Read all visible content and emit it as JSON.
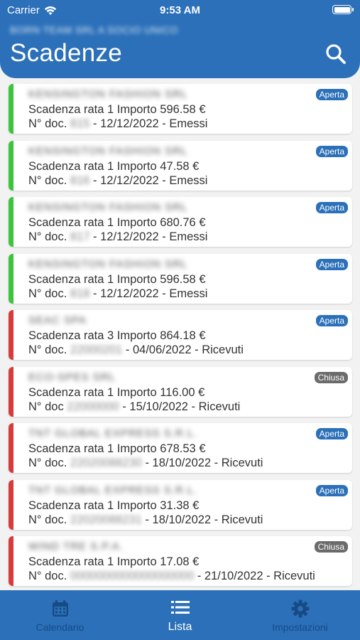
{
  "status_bar": {
    "carrier": "Carrier",
    "time": "9:53 AM"
  },
  "header": {
    "subtitle": "BORN TEAM SRL A SOCIO UNICO",
    "title": "Scadenze",
    "search_icon": "search-icon"
  },
  "colors": {
    "primary": "#2b70b9",
    "green": "#3dc43d",
    "red": "#d93b3b",
    "open_badge": "#2b70b9",
    "closed_badge": "#6b6b6b"
  },
  "items": [
    {
      "company": "KENSINGTON FASHION SRL",
      "line1": "Scadenza rata 1 Importo 596.58 €",
      "doc_prefix": "N° doc.",
      "doc_num": "815",
      "doc_suffix": "- 12/12/2022 - Emessi",
      "status": "Aperta",
      "type": "emessi"
    },
    {
      "company": "KENSINGTON FASHION SRL",
      "line1": "Scadenza rata 1 Importo 47.58 €",
      "doc_prefix": "N° doc.",
      "doc_num": "816",
      "doc_suffix": "- 12/12/2022 - Emessi",
      "status": "Aperta",
      "type": "emessi"
    },
    {
      "company": "KENSINGTON FASHION SRL",
      "line1": "Scadenza rata 1 Importo 680.76 €",
      "doc_prefix": "N° doc.",
      "doc_num": "817",
      "doc_suffix": "- 12/12/2022 - Emessi",
      "status": "Aperta",
      "type": "emessi"
    },
    {
      "company": "KENSINGTON FASHION SRL",
      "line1": "Scadenza rata 1 Importo 596.58 €",
      "doc_prefix": "N° doc.",
      "doc_num": "818",
      "doc_suffix": "- 12/12/2022 - Emessi",
      "status": "Aperta",
      "type": "emessi"
    },
    {
      "company": "SEAC SPA",
      "line1": "Scadenza rata 3 Importo 864.18 €",
      "doc_prefix": "N° doc.",
      "doc_num": "22000201",
      "doc_suffix": "- 04/06/2022 - Ricevuti",
      "status": "Aperta",
      "type": "ricevuti"
    },
    {
      "company": "ECO-SPES SRL",
      "line1": "Scadenza rata 1 Importo 116.00 €",
      "doc_prefix": "N° doc",
      "doc_num": "22000000",
      "doc_suffix": "- 15/10/2022 - Ricevuti",
      "status": "Chiusa",
      "type": "ricevuti"
    },
    {
      "company": "TNT GLOBAL EXPRESS S.R.L.",
      "line1": "Scadenza rata 1 Importo 678.53 €",
      "doc_prefix": "N° doc.",
      "doc_num": "22020088230",
      "doc_suffix": "- 18/10/2022 - Ricevuti",
      "status": "Aperta",
      "type": "ricevuti"
    },
    {
      "company": "TNT GLOBAL EXPRESS S.R.L.",
      "line1": "Scadenza rata 1 Importo 31.38 €",
      "doc_prefix": "N° doc.",
      "doc_num": "22020088231",
      "doc_suffix": "- 18/10/2022 - Ricevuti",
      "status": "Aperta",
      "type": "ricevuti"
    },
    {
      "company": "WIND TRE S.P.A.",
      "line1": "Scadenza rata 1 Importo 17.08 €",
      "doc_prefix": "N° doc.",
      "doc_num": "0000000000000000000",
      "doc_suffix": "- 21/10/2022 - Ricevuti",
      "status": "Chiusa",
      "type": "ricevuti"
    }
  ],
  "tabbar": {
    "tabs": [
      {
        "label": "Calendario",
        "icon": "calendar-icon",
        "active": false
      },
      {
        "label": "Lista",
        "icon": "list-icon",
        "active": true
      },
      {
        "label": "Impostazioni",
        "icon": "gear-icon",
        "active": false
      }
    ]
  }
}
